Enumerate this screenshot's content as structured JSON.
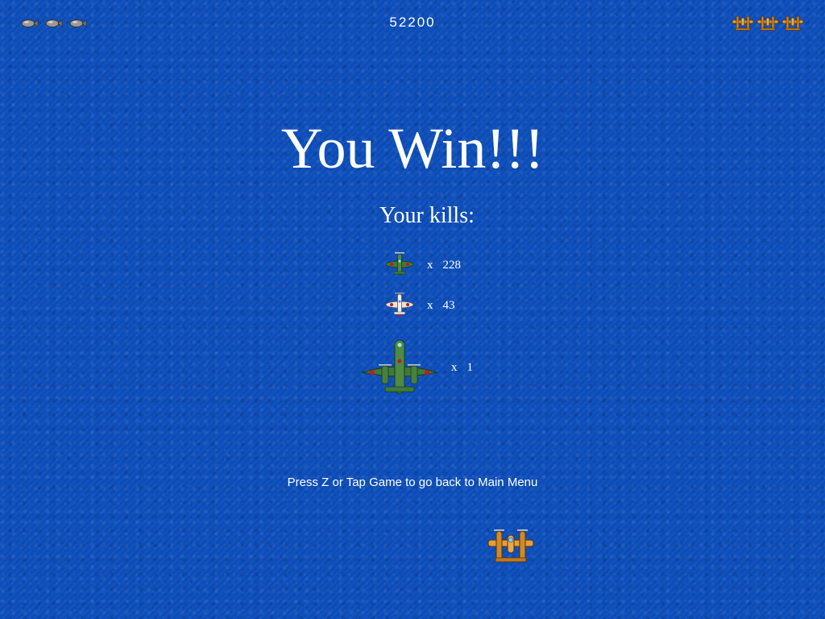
{
  "hud": {
    "bombs": [
      "bomb-icon",
      "bomb-icon",
      "bomb-icon"
    ],
    "score": "52200",
    "lives": [
      "player-plane-icon",
      "player-plane-icon",
      "player-plane-icon"
    ]
  },
  "screen": {
    "title": "You Win!!!",
    "kills_heading": "Your kills:",
    "prompt": "Press Z or Tap Game to go back to Main Menu"
  },
  "kills": [
    {
      "enemy": "green-fighter-icon",
      "x": "x",
      "count": "228"
    },
    {
      "enemy": "white-fighter-icon",
      "x": "x",
      "count": "43"
    },
    {
      "enemy": "green-bomber-icon",
      "x": "x",
      "count": "1"
    }
  ],
  "colors": {
    "background": "#0b4cb8",
    "text": "#ffffff",
    "player_plane": "#d08a2a",
    "enemy_green": "#3f7a3a",
    "enemy_white": "#e8e4e0",
    "roundel": "#c81818"
  }
}
